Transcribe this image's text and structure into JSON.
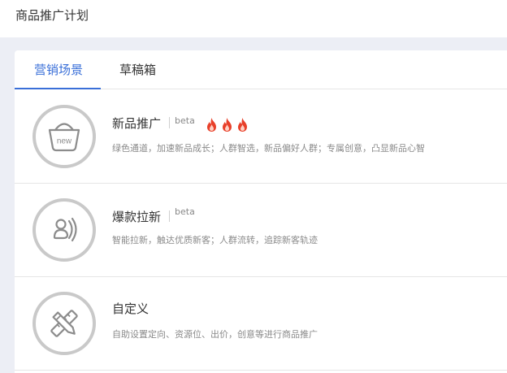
{
  "page": {
    "title": "商品推广计划"
  },
  "tabs": [
    {
      "label": "营销场景",
      "active": true
    },
    {
      "label": "草稿箱",
      "active": false
    }
  ],
  "cards": [
    {
      "title": "新品推广",
      "badge": "beta",
      "hot_level": 3,
      "icon": "shopping-basket-new-icon",
      "icon_text": "new",
      "description": "绿色通道，加速新品成长；人群智选，新品偏好人群；专属创意，凸显新品心智"
    },
    {
      "title": "爆款拉新",
      "badge": "beta",
      "icon": "user-attract-icon",
      "description": "智能拉新，触达优质新客；人群流转，追踪新客轨迹"
    },
    {
      "title": "自定义",
      "icon": "pencil-ruler-icon",
      "description": "自助设置定向、资源位、出价，创意等进行商品推广"
    }
  ],
  "colors": {
    "accent": "#3a6fd8",
    "ring": "#c9c9c9",
    "flame": "#e8402a",
    "background": "#eceef5"
  }
}
